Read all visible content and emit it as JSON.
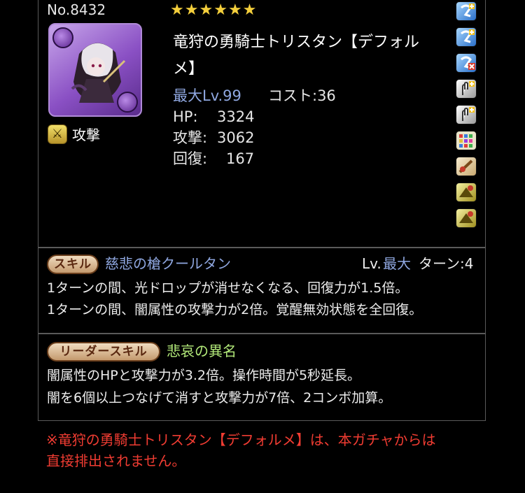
{
  "monster": {
    "number": "No.8432",
    "stars": [
      "★",
      "★",
      "★",
      "★",
      "★",
      "★"
    ],
    "name_line1": "竜狩の勇騎士トリスタン【デフォル",
    "name_line2": "メ】",
    "type_label": "攻撃",
    "max_level": "最大Lv.99",
    "cost": "コスト:36",
    "hp_label": "HP:",
    "hp_value": "3324",
    "atk_label": "攻撃:",
    "atk_value": "3062",
    "rcv_label": "回復:",
    "rcv_value": "167",
    "attribute_colors": {
      "main": "#8a50c4",
      "sub": "#8a50c4"
    }
  },
  "awakenings": [
    {
      "icon": "skill-boost-plus-icon",
      "color": "#3a8fe0"
    },
    {
      "icon": "skill-boost-plus-icon",
      "color": "#3a8fe0"
    },
    {
      "icon": "skill-boost-minus-icon",
      "color": "#d04030"
    },
    {
      "icon": "time-extend-plus-icon",
      "color": "#e8e8e8"
    },
    {
      "icon": "time-extend-plus-icon",
      "color": "#e8e8e8"
    },
    {
      "icon": "board-rainbow-icon",
      "color": "#7a4fc8"
    },
    {
      "icon": "sword-guard-icon",
      "color": "#e5d8b8"
    },
    {
      "icon": "attacker-killer-icon",
      "color": "#c8b84a"
    },
    {
      "icon": "attacker-killer-icon",
      "color": "#c8b84a"
    }
  ],
  "skill": {
    "badge": "スキル",
    "name": "慈悲の槍クールタン",
    "level_prefix": "Lv.",
    "level_value": "最大",
    "turns": "ターン:4",
    "desc_line1": "1ターンの間、光ドロップが消せなくなる、回復力が1.5倍。",
    "desc_line2": "1ターンの間、闇属性の攻撃力が2倍。覚醒無効状態を全回復。"
  },
  "leader_skill": {
    "badge": "リーダースキル",
    "name": "悲哀の異名",
    "desc_line1": "闇属性のHPと攻撃力が3.2倍。操作時間が5秒延長。",
    "desc_line2": "闇を6個以上つなげて消すと攻撃力が7倍、2コンボ加算。"
  },
  "notice": {
    "line1": "※竜狩の勇騎士トリスタン【デフォルメ】は、本ガチャからは",
    "line2": "直接排出されません。"
  }
}
